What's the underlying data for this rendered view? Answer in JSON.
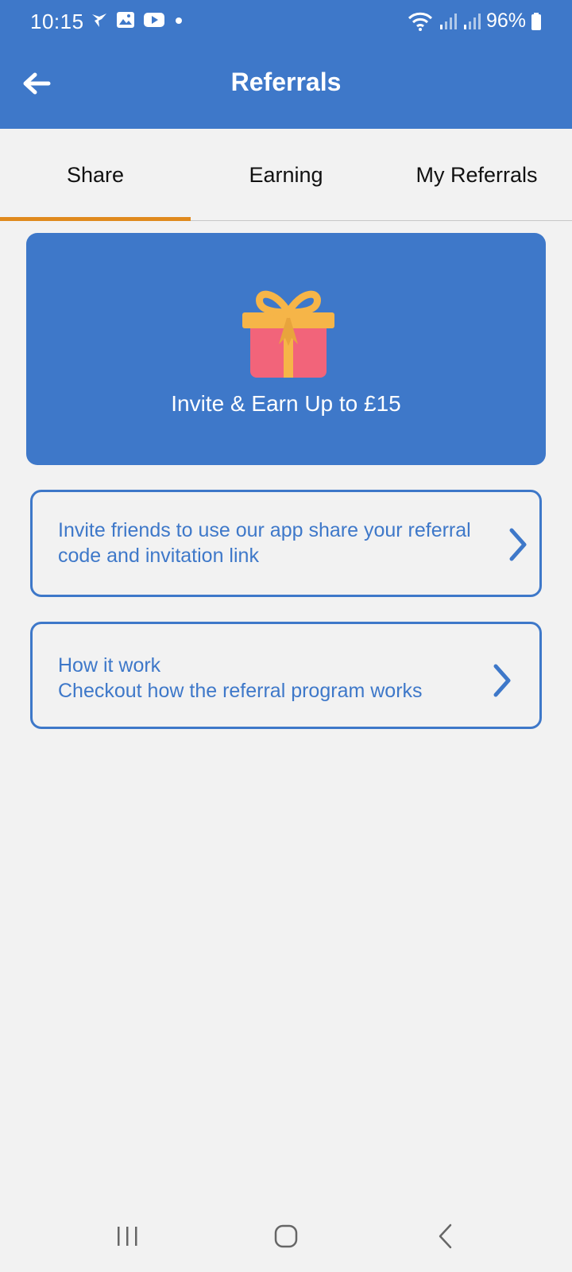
{
  "status_bar": {
    "time": "10:15",
    "icons": [
      "wifi-calling-icon",
      "image-icon",
      "youtube-icon",
      "dot-icon"
    ],
    "battery": "96%",
    "right_icons": [
      "wifi-icon",
      "signal-icon",
      "signal-icon",
      "battery-icon"
    ]
  },
  "app_bar": {
    "title": "Referrals",
    "back_icon": "arrow-left-icon"
  },
  "tabs": [
    {
      "label": "Share",
      "active": true
    },
    {
      "label": "Earning",
      "active": false
    },
    {
      "label": "My Referrals",
      "active": false
    }
  ],
  "hero": {
    "icon": "gift-icon",
    "text": "Invite & Earn Up to £15"
  },
  "options": [
    {
      "lines": [
        "Invite friends to use our app share your referral",
        "code and invitation link"
      ],
      "icon": "chevron-right-icon"
    },
    {
      "lines": [
        "How it work",
        "Checkout how the referral program works"
      ],
      "icon": "chevron-right-icon"
    }
  ],
  "nav_bar": {
    "items": [
      "recent-apps-icon",
      "home-icon",
      "back-icon"
    ]
  },
  "colors": {
    "primary": "#3e78c9",
    "accent": "#e08a1e",
    "background": "#f2f2f2",
    "gift_box": "#f2647a",
    "gift_ribbon": "#f6b548"
  }
}
